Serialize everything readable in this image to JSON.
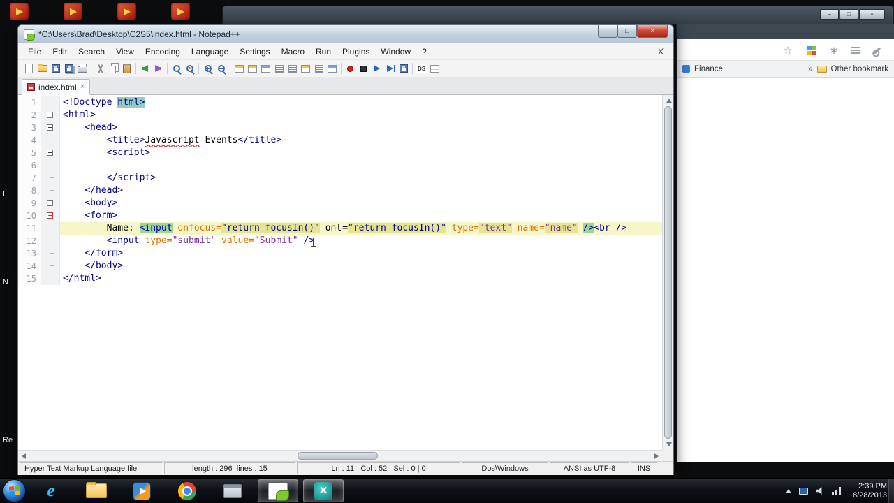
{
  "desktop": {
    "top_shortcut_count": 4,
    "left_edge_labels": [
      "I",
      "N",
      "Re"
    ]
  },
  "browser": {
    "window_controls": {
      "minimize": "–",
      "maximize": "□",
      "close": "×"
    },
    "toolbar": {
      "star_glyph": "☆",
      "asterisk_glyph": "∗"
    },
    "bookmarks_bar": {
      "finance_label": "Finance",
      "overflow_chevron": "»",
      "other_bookmarks_label": "Other bookmark"
    }
  },
  "notepad": {
    "title": "*C:\\Users\\Brad\\Desktop\\C2S5\\index.html - Notepad++",
    "window_controls": {
      "minimize": "–",
      "maximize": "□",
      "close": "×"
    },
    "menus": [
      "File",
      "Edit",
      "Search",
      "View",
      "Encoding",
      "Language",
      "Settings",
      "Macro",
      "Run",
      "Plugins",
      "Window",
      "?"
    ],
    "menu_close_label": "X",
    "tab": {
      "label": "index.html",
      "close_glyph": "×"
    },
    "toolbar": [
      {
        "name": "new-file",
        "kind": "doc"
      },
      {
        "name": "open-file",
        "kind": "folder"
      },
      {
        "name": "save",
        "kind": "disk"
      },
      {
        "name": "save-all",
        "kind": "disks"
      },
      {
        "name": "print",
        "kind": "print"
      },
      {
        "sep": true
      },
      {
        "name": "cut",
        "kind": "cut"
      },
      {
        "name": "copy",
        "kind": "copy"
      },
      {
        "name": "paste",
        "kind": "paste"
      },
      {
        "sep": true
      },
      {
        "name": "undo",
        "kind": "arrowl"
      },
      {
        "name": "redo",
        "kind": "arrowr"
      },
      {
        "sep": true
      },
      {
        "name": "find",
        "kind": "mag"
      },
      {
        "name": "replace",
        "kind": "magr"
      },
      {
        "sep": true
      },
      {
        "name": "zoom-in",
        "kind": "magz"
      },
      {
        "name": "zoom-out",
        "kind": "magz2"
      },
      {
        "sep": true
      },
      {
        "name": "sync-scroll-vertical",
        "kind": "win"
      },
      {
        "name": "sync-scroll-horizontal",
        "kind": "win"
      },
      {
        "name": "word-wrap",
        "kind": "win2"
      },
      {
        "name": "show-all-characters",
        "kind": "list"
      },
      {
        "name": "indent-guide",
        "kind": "list"
      },
      {
        "name": "document-map",
        "kind": "win"
      },
      {
        "name": "function-list",
        "kind": "list2"
      },
      {
        "name": "folder-as-workspace",
        "kind": "win2"
      },
      {
        "sep": true
      },
      {
        "name": "record-macro",
        "kind": "rec"
      },
      {
        "name": "stop-recording",
        "kind": "stop"
      },
      {
        "name": "playback-macro",
        "kind": "play"
      },
      {
        "name": "run-macro-multiple",
        "kind": "play2"
      },
      {
        "name": "save-macro",
        "kind": "disk"
      },
      {
        "sep": true
      },
      {
        "name": "dspellcheck",
        "kind": "ds",
        "glyph": "DS"
      },
      {
        "name": "doc-switcher",
        "kind": "grid"
      }
    ],
    "code": {
      "palette": {
        "tag": "#000090",
        "attr": "#e07000",
        "val": "#7a30a0",
        "text": "#000000"
      },
      "highlights": {
        "green": "#9cd69c",
        "khaki": "#e4e494",
        "teal": "#96ccc0"
      },
      "lines": [
        {
          "n": 1,
          "fold": "",
          "segs": [
            {
              "t": "<!Doctype ",
              "c": "tag"
            },
            {
              "t": "html>",
              "c": "tag",
              "bg": "teal"
            }
          ]
        },
        {
          "n": 2,
          "fold": "box",
          "segs": [
            {
              "t": "<html>",
              "c": "tag"
            }
          ]
        },
        {
          "n": 3,
          "fold": "box",
          "segs": [
            {
              "t": "    ",
              "c": "text"
            },
            {
              "t": "<head>",
              "c": "tag"
            }
          ]
        },
        {
          "n": 4,
          "fold": "bar",
          "segs": [
            {
              "t": "        ",
              "c": "text"
            },
            {
              "t": "<title>",
              "c": "tag"
            },
            {
              "t": "Javascript",
              "c": "text",
              "u": true
            },
            {
              "t": " Events",
              "c": "text"
            },
            {
              "t": "</title>",
              "c": "tag"
            }
          ]
        },
        {
          "n": 5,
          "fold": "box",
          "segs": [
            {
              "t": "        ",
              "c": "text"
            },
            {
              "t": "<script>",
              "c": "tag"
            }
          ]
        },
        {
          "n": 6,
          "fold": "bar",
          "segs": []
        },
        {
          "n": 7,
          "fold": "corner",
          "segs": [
            {
              "t": "        ",
              "c": "text"
            },
            {
              "t": "</script>",
              "c": "tag"
            }
          ]
        },
        {
          "n": 8,
          "fold": "corner",
          "segs": [
            {
              "t": "    ",
              "c": "text"
            },
            {
              "t": "</head>",
              "c": "tag"
            }
          ]
        },
        {
          "n": 9,
          "fold": "box",
          "segs": [
            {
              "t": "    ",
              "c": "text"
            },
            {
              "t": "<body>",
              "c": "tag"
            }
          ]
        },
        {
          "n": 10,
          "fold": "boxr",
          "segs": [
            {
              "t": "    ",
              "c": "text"
            },
            {
              "t": "<form>",
              "c": "tag"
            }
          ]
        },
        {
          "n": 11,
          "fold": "bar",
          "cur": true,
          "segs": [
            {
              "t": "        Name: ",
              "c": "text"
            },
            {
              "t": "<input",
              "c": "tag",
              "bg": "green"
            },
            {
              "t": " ",
              "c": "text"
            },
            {
              "t": "onfocus",
              "c": "attr"
            },
            {
              "t": "=",
              "c": "attr"
            },
            {
              "t": "\"return focusIn()\"",
              "c": "tag",
              "bg": "khaki"
            },
            {
              "t": " onl",
              "c": "text",
              "caret": true
            },
            {
              "t": "=",
              "c": "text"
            },
            {
              "t": "\"return focusIn()\"",
              "c": "tag",
              "bg": "khaki"
            },
            {
              "t": " ",
              "c": "text"
            },
            {
              "t": "type",
              "c": "attr"
            },
            {
              "t": "=",
              "c": "attr"
            },
            {
              "t": "\"text\"",
              "c": "val",
              "bg": "khaki"
            },
            {
              "t": " ",
              "c": "text"
            },
            {
              "t": "name",
              "c": "attr"
            },
            {
              "t": "=",
              "c": "attr"
            },
            {
              "t": "\"name\"",
              "c": "val",
              "bg": "khaki"
            },
            {
              "t": " ",
              "c": "text"
            },
            {
              "t": "/>",
              "c": "tag",
              "bg": "green"
            },
            {
              "t": "<br",
              "c": "tag"
            },
            {
              "t": " />",
              "c": "tag"
            }
          ]
        },
        {
          "n": 12,
          "fold": "bar",
          "segs": [
            {
              "t": "        ",
              "c": "text"
            },
            {
              "t": "<input",
              "c": "tag"
            },
            {
              "t": " ",
              "c": "text"
            },
            {
              "t": "type",
              "c": "attr"
            },
            {
              "t": "=",
              "c": "attr"
            },
            {
              "t": "\"submit\"",
              "c": "val"
            },
            {
              "t": " ",
              "c": "text"
            },
            {
              "t": "value",
              "c": "attr"
            },
            {
              "t": "=",
              "c": "attr"
            },
            {
              "t": "\"Submit\"",
              "c": "val"
            },
            {
              "t": " ",
              "c": "text"
            },
            {
              "t": "/>",
              "c": "tag"
            }
          ]
        },
        {
          "n": 13,
          "fold": "corner",
          "segs": [
            {
              "t": "    ",
              "c": "text"
            },
            {
              "t": "</form>",
              "c": "tag"
            }
          ]
        },
        {
          "n": 14,
          "fold": "corner",
          "segs": [
            {
              "t": "    ",
              "c": "text"
            },
            {
              "t": "</body>",
              "c": "tag"
            }
          ]
        },
        {
          "n": 15,
          "fold": "",
          "segs": [
            {
              "t": "</html>",
              "c": "tag"
            }
          ]
        }
      ]
    },
    "status": [
      {
        "name": "doc-type",
        "text": "Hyper Text Markup Language file"
      },
      {
        "name": "length-lines",
        "text": "length : 296  lines : 15"
      },
      {
        "name": "cursor-position",
        "text": "Ln : 11   Col : 52   Sel : 0 | 0"
      },
      {
        "name": "eol-format",
        "text": "Dos\\Windows"
      },
      {
        "name": "encoding",
        "text": "ANSI as UTF-8"
      },
      {
        "name": "insert-mode",
        "text": "INS"
      }
    ]
  },
  "taskbar": {
    "buttons": [
      {
        "name": "internet-explorer",
        "kind": "ie",
        "glyph": "e"
      },
      {
        "name": "windows-explorer",
        "kind": "folderbtn"
      },
      {
        "name": "media-player",
        "kind": "media"
      },
      {
        "name": "chrome",
        "kind": "chrome"
      },
      {
        "name": "remote-desktop",
        "kind": "grayapp"
      },
      {
        "name": "notepad-plus-plus",
        "kind": "npp",
        "active": true
      },
      {
        "name": "camtasia-recorder",
        "kind": "cam",
        "glyph": "×",
        "active": true
      }
    ],
    "clock": {
      "time": "2:39 PM",
      "date": "8/28/2013"
    }
  }
}
